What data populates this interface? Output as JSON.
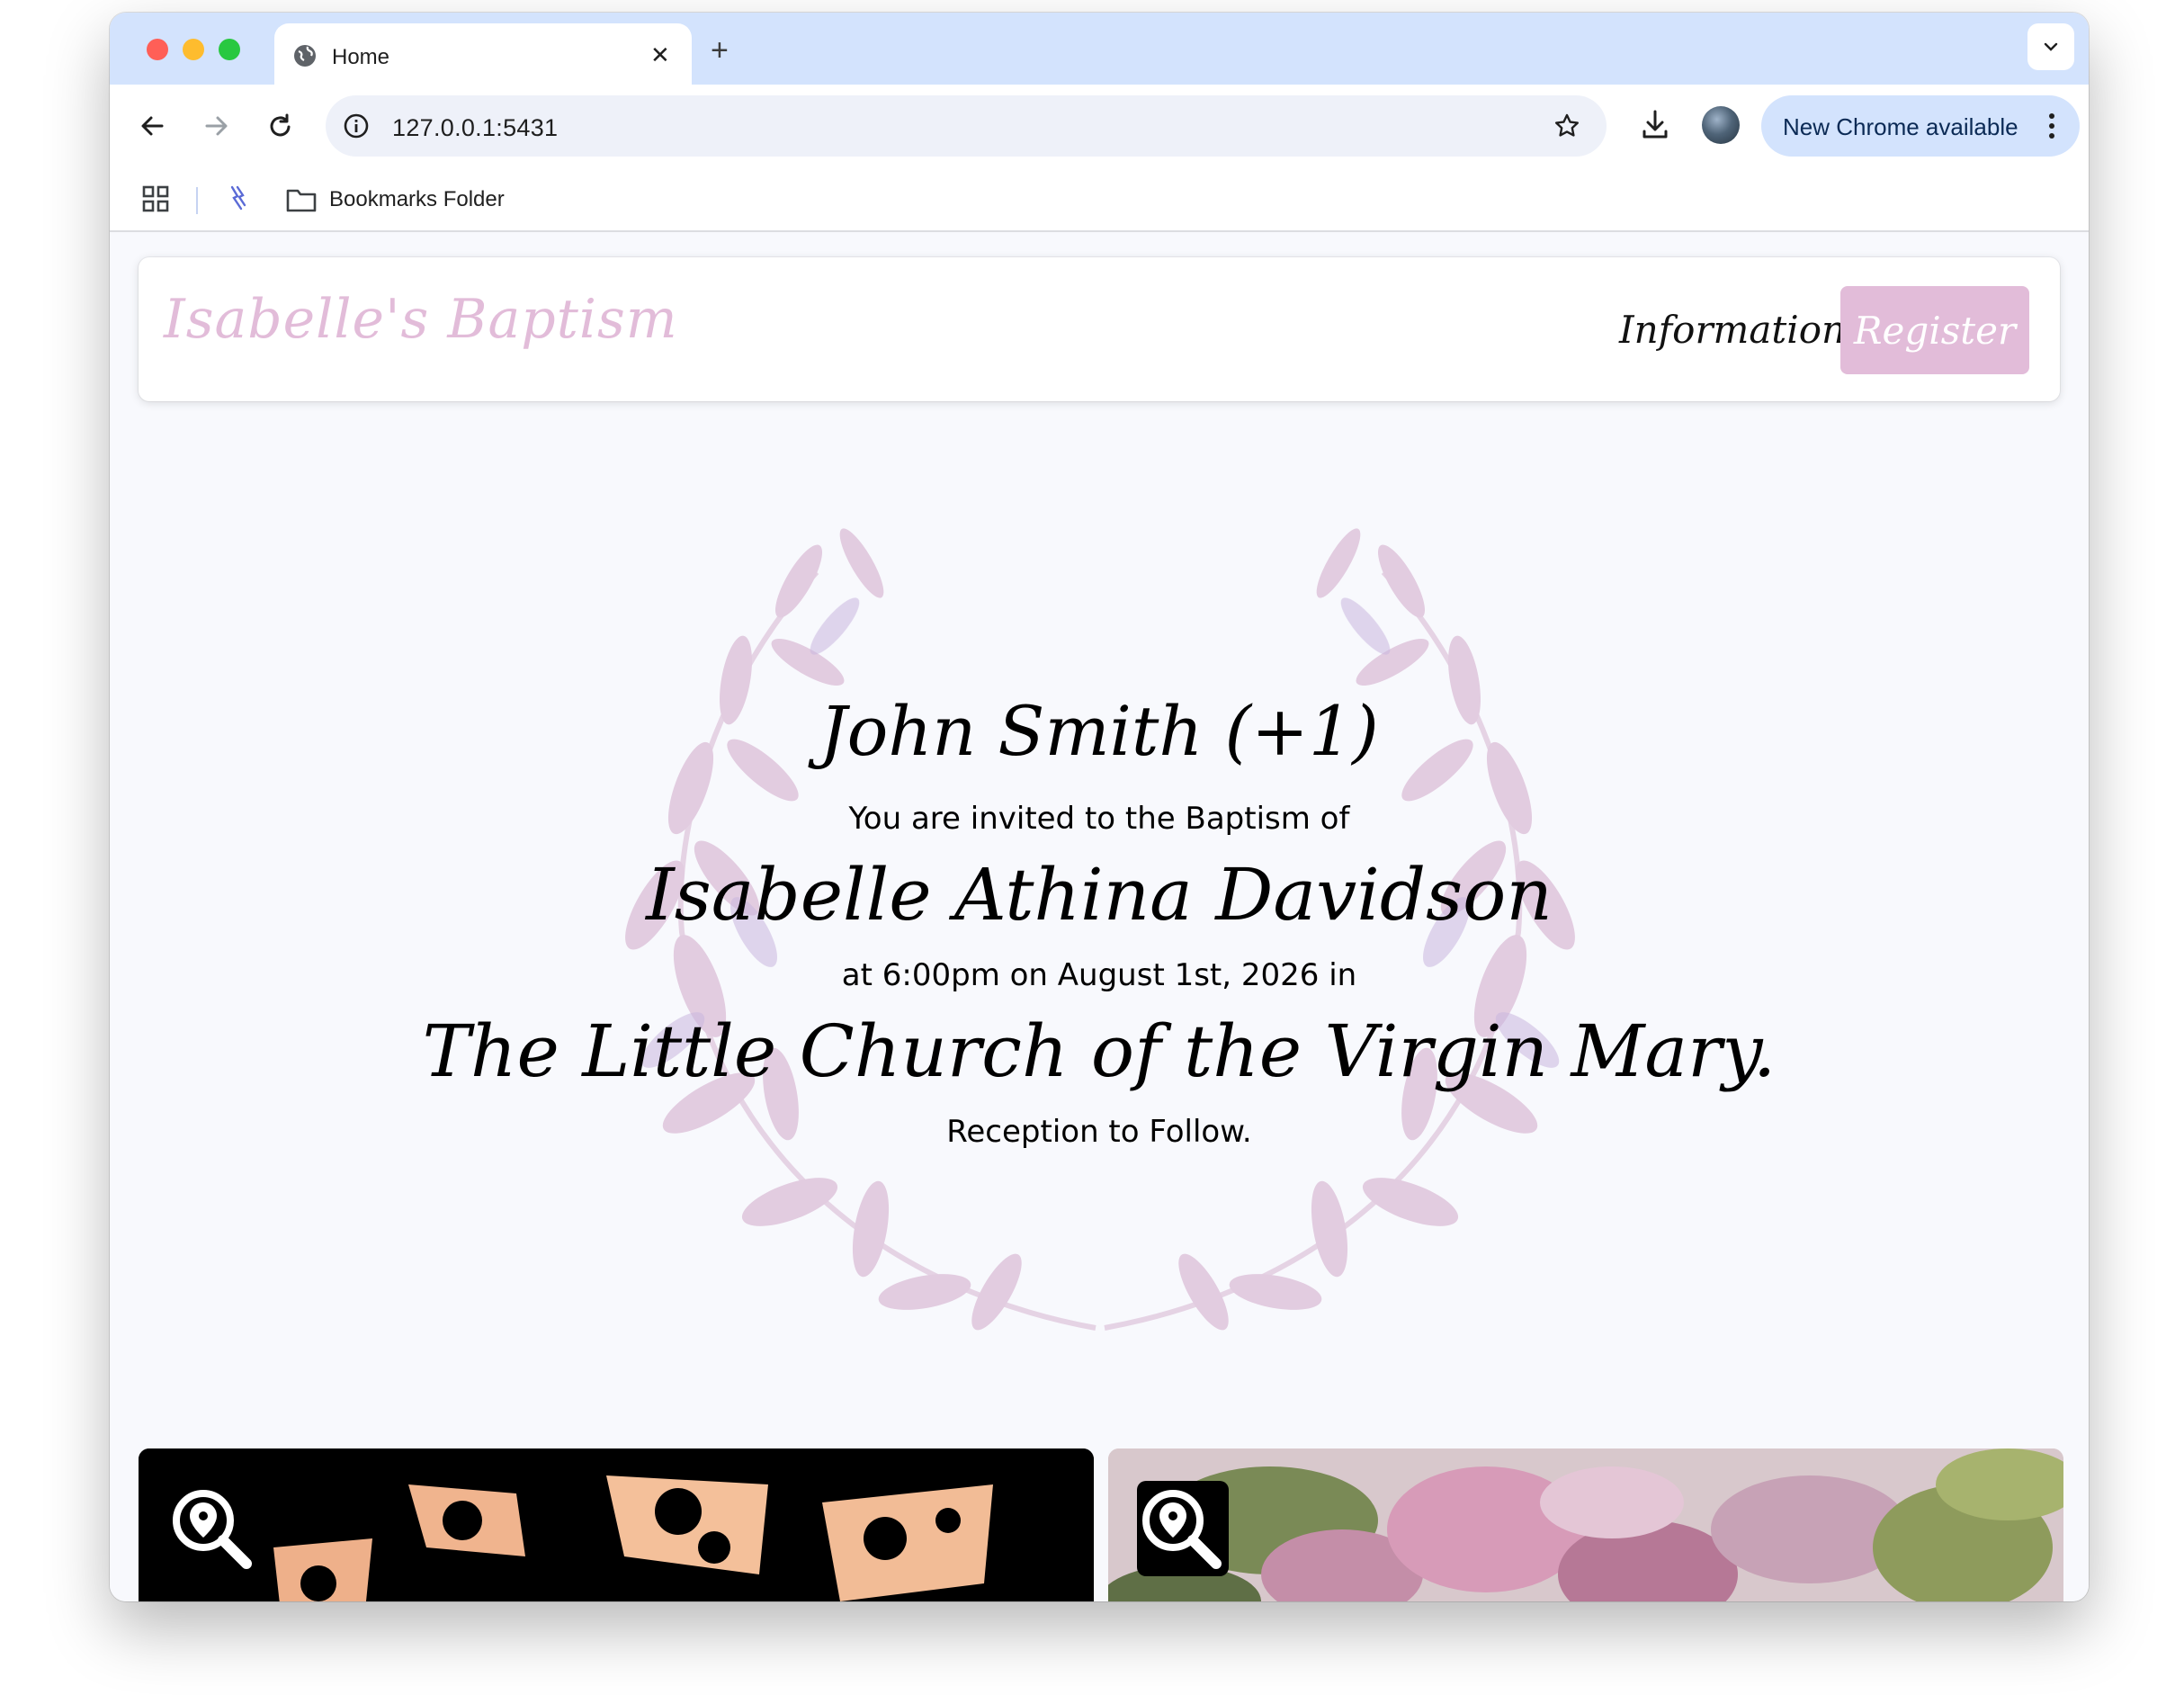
{
  "browser": {
    "tab_title": "Home",
    "url": "127.0.0.1:5431",
    "update_label": "New Chrome available",
    "bookmark_folder": "Bookmarks Folder"
  },
  "site": {
    "title": "Isabelle's Baptism",
    "nav": {
      "information": "Information",
      "register": "Register"
    },
    "invitation": {
      "guest": "John Smith (+1)",
      "invited_line": "You are invited to the Baptism of",
      "child_name": "Isabelle Athina Davidson",
      "datetime_line": "at 6:00pm on August 1st, 2026 in",
      "venue": "The Little Church of the Virgin Mary.",
      "reception": "Reception to Follow."
    }
  },
  "colors": {
    "accent_pink": "#e2bcd9",
    "page_bg": "#f8f9fd",
    "tabstrip": "#d3e3fd"
  },
  "icons": {
    "card_badge": "map-search-icon"
  }
}
